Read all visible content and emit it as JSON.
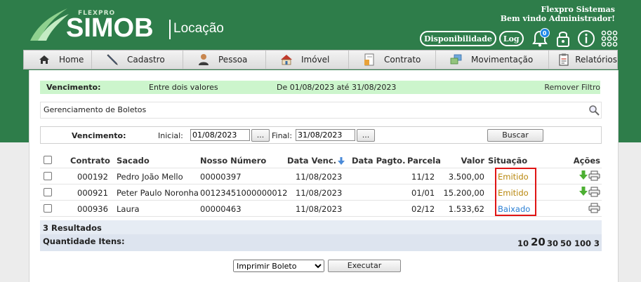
{
  "header": {
    "brand_small": "FLEXPRO",
    "brand_big": "SIMOB",
    "brand_sub": "Locação",
    "company": "Flexpro Sistemas",
    "welcome": "Bem vindo Administrador!",
    "availability_label": "Disponibilidade",
    "log_label": "Log",
    "notification_count": "0"
  },
  "nav": {
    "items": [
      {
        "label": "Home",
        "icon": "home-icon"
      },
      {
        "label": "Cadastro",
        "icon": "pen-icon"
      },
      {
        "label": "Pessoa",
        "icon": "person-icon"
      },
      {
        "label": "Imóvel",
        "icon": "house-icon"
      },
      {
        "label": "Contrato",
        "icon": "contract-icon"
      },
      {
        "label": "Movimentação",
        "icon": "movement-icon"
      },
      {
        "label": "Relatórios",
        "icon": "report-icon"
      }
    ]
  },
  "filter": {
    "label": "Vencimento:",
    "mode": "Entre dois valores",
    "range": "De 01/08/2023 até 31/08/2023",
    "remove": "Remover Filtro"
  },
  "page_title": "Gerenciamento de Boletos",
  "search": {
    "label": "Vencimento:",
    "initial_label": "Inicial:",
    "initial_value": "01/08/2023",
    "final_label": "Final:",
    "final_value": "31/08/2023",
    "picker_label": "...",
    "search_button": "Buscar"
  },
  "table": {
    "headers": {
      "contrato": "Contrato",
      "sacado": "Sacado",
      "nosso_numero": "Nosso Número",
      "data_venc": "Data Venc.",
      "data_pagto": "Data Pagto.",
      "parcela": "Parcela",
      "valor": "Valor",
      "situacao": "Situação",
      "acoes": "Ações"
    },
    "rows": [
      {
        "contrato": "000192",
        "sacado": "Pedro João Mello",
        "nosso_numero": "00000397",
        "data_venc": "11/08/2023",
        "data_pagto": "",
        "parcela": "11/12",
        "valor": "3.500,00",
        "situacao": "Emitido"
      },
      {
        "contrato": "000921",
        "sacado": "Peter Paulo Noronha",
        "nosso_numero": "00123451000000012",
        "data_venc": "11/08/2023",
        "data_pagto": "",
        "parcela": "01/01",
        "valor": "15.200,00",
        "situacao": "Emitido"
      },
      {
        "contrato": "000936",
        "sacado": "Laura",
        "nosso_numero": "00000463",
        "data_venc": "11/08/2023",
        "data_pagto": "",
        "parcela": "02/12",
        "valor": "1.533,62",
        "situacao": "Baixado"
      }
    ],
    "results": "3 Resultados",
    "quantity_label": "Quantidade Itens:",
    "page_sizes": [
      "10",
      "20",
      "30",
      "50",
      "100",
      "3"
    ]
  },
  "actions": {
    "select_value": "Imprimir Boleto",
    "execute_button": "Executar"
  },
  "colors": {
    "brand_green": "#2e7d4a",
    "filter_bg": "#ccf5cc",
    "status_emitido": "#b8860b",
    "status_baixado": "#2a7fd4",
    "highlight": "#e01414"
  }
}
